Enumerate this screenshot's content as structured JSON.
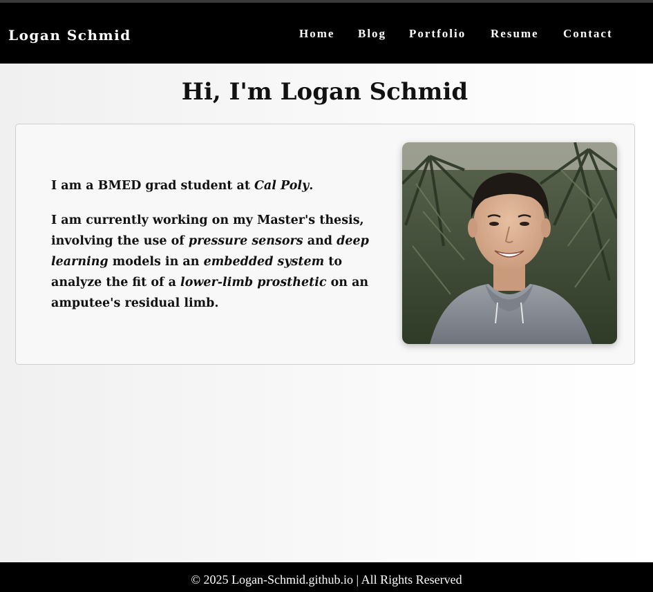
{
  "navbar": {
    "brand": "Logan Schmid",
    "links": [
      {
        "label": "Home"
      },
      {
        "label": "Blog"
      },
      {
        "label": "Portfolio"
      },
      {
        "label": "Resume"
      },
      {
        "label": "Contact"
      }
    ]
  },
  "main": {
    "title": "Hi, I'm Logan Schmid",
    "bio": {
      "p1": {
        "a": "I am a BMED grad student at ",
        "b": "Cal Poly",
        "c": "."
      },
      "p2": {
        "a": "I am currently working on my Master's thesis, involving the use of ",
        "b": "pressure sensors",
        "c": " and ",
        "d": "deep learning",
        "e": " models in an ",
        "f": "embedded system",
        "g": " to analyze the fit of a ",
        "h": "lower-limb prosthetic",
        "i": " on an amputee's residual limb."
      }
    },
    "photo_icon": "portrait-photo"
  },
  "footer": {
    "text": "© 2025 Logan-Schmid.github.io | All Rights Reserved"
  },
  "colors": {
    "navbar_bg": "#000000",
    "nav_text": "#ffffff",
    "card_bg": "#f8f8f8",
    "footer_bg": "#000000"
  }
}
